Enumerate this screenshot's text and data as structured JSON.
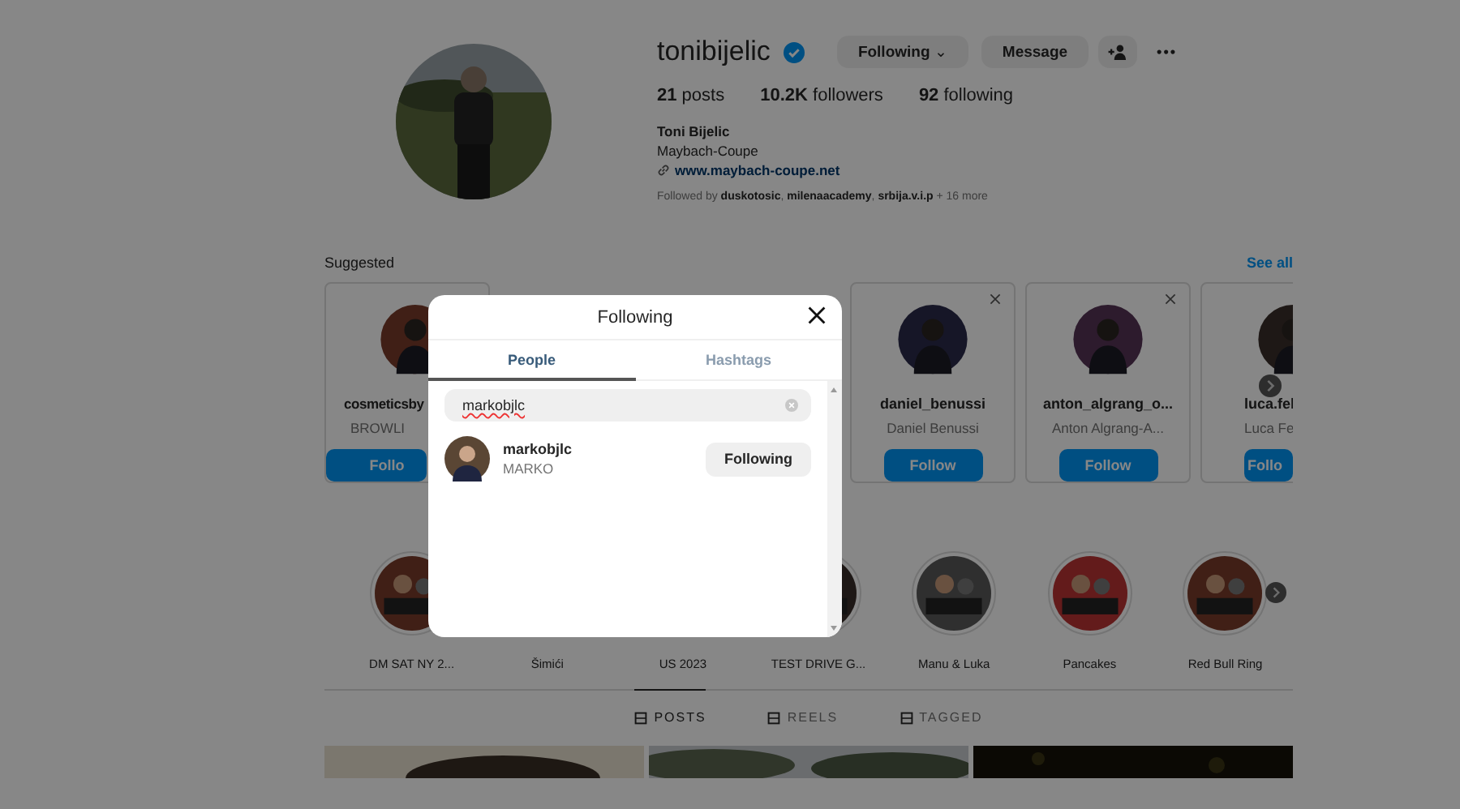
{
  "profile": {
    "username": "tonibijelic",
    "verified": true,
    "follow_button": "Following",
    "caret": "⌄",
    "message_button": "Message",
    "more": "•••",
    "stats": [
      {
        "value": "21",
        "label": "posts"
      },
      {
        "value": "10.2K",
        "label": "followers"
      },
      {
        "value": "92",
        "label": "following"
      }
    ],
    "name": "Toni Bijelic",
    "bio": "Maybach-Coupe",
    "link": "www.maybach-coupe.net",
    "followed_by": "Followed by **duskotosic**, **milenaacademy**, **srbija.v.i.p** + 16 more"
  },
  "suggested": {
    "title": "Suggested",
    "see_all": "See all",
    "cards": [
      {
        "kind": "cut-left",
        "username": "cosmeticsby",
        "name": "BROWLI",
        "button": "Follo"
      },
      {
        "kind": "full",
        "username": "daniel_benussi",
        "name": "Daniel Benussi",
        "button": "Follow"
      },
      {
        "kind": "full",
        "username": "anton_algrang_o...",
        "name": "Anton Algrang-A...",
        "button": "Follow"
      },
      {
        "kind": "cut-right",
        "username": "luca.fel",
        "name": "Luca Fe",
        "button": "Follo"
      }
    ]
  },
  "highlights": [
    {
      "label": "DM SAT NY 2...",
      "kind": "picture"
    },
    {
      "label": "Šimići"
    },
    {
      "label": "US 2023"
    },
    {
      "label": "TEST DRIVE G...",
      "kind": "picture"
    },
    {
      "label": "Manu & Luka",
      "kind": "picture"
    },
    {
      "label": "Pancakes",
      "kind": "picture"
    },
    {
      "label": "Red Bull Ring",
      "kind": "picture"
    }
  ],
  "profile_tabs": [
    {
      "label": "POSTS",
      "selected": true
    },
    {
      "label": "REELS",
      "selected": false
    },
    {
      "label": "TAGGED",
      "selected": false
    }
  ],
  "modal": {
    "title": "Following",
    "tabs": [
      {
        "label": "People",
        "selected": true
      },
      {
        "label": "Hashtags",
        "selected": false
      }
    ],
    "search": {
      "value": "markobjlc"
    },
    "results": [
      {
        "username": "markobjlc",
        "name": "MARKO",
        "button": "Following"
      }
    ]
  }
}
